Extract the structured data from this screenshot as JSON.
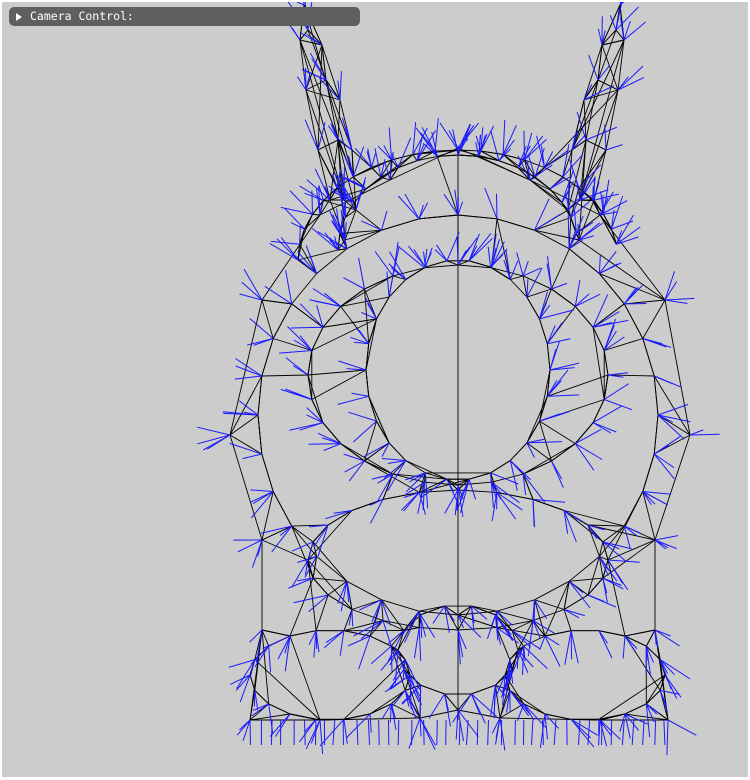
{
  "panel": {
    "camera_control_label": "Camera Control:",
    "expand_icon": "triangle-right-icon"
  },
  "colors": {
    "background": "#cccccc",
    "wireframe": "#000000",
    "normals": "#1a1aff",
    "panel": "#5f5f5f"
  }
}
